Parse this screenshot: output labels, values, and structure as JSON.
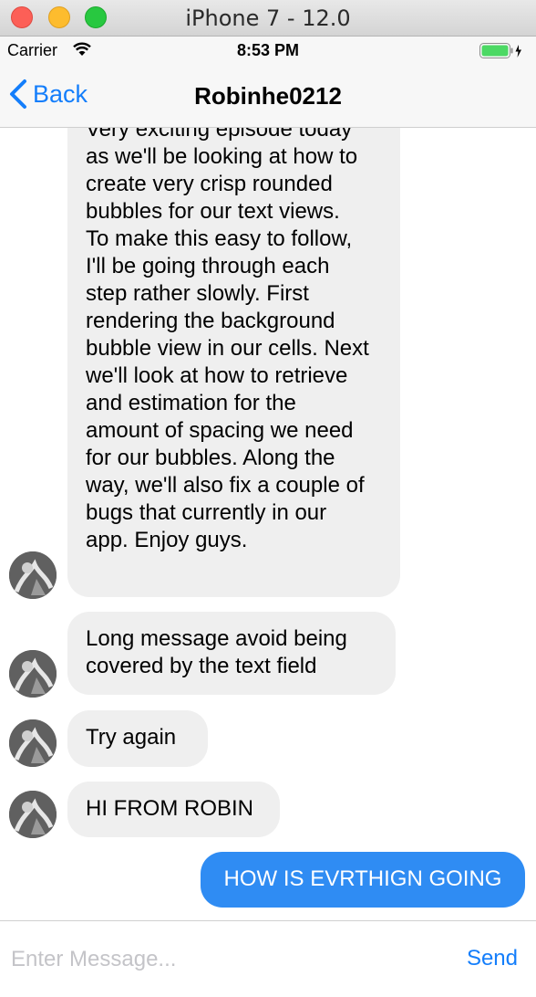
{
  "simulator": {
    "title": "iPhone 7 - 12.0"
  },
  "statusbar": {
    "carrier": "Carrier",
    "time": "8:53 PM"
  },
  "navbar": {
    "back_label": "Back",
    "title": "Robinhe0212"
  },
  "messages": [
    {
      "direction": "incoming",
      "lines": [
        "Very exciting episode today",
        "as we'll be looking at how to",
        "create very crisp rounded",
        "bubbles for our text views.",
        "To make this easy to follow,",
        "I'll be going through each",
        "step rather slowly. First",
        "rendering the background",
        "bubble view in our cells. Next",
        "we'll look at how to retrieve",
        "and estimation for the",
        "amount of spacing we need",
        "for our bubbles.  Along the",
        "way, we'll also fix a couple of",
        "bugs that currently in our",
        "app.  Enjoy guys."
      ]
    },
    {
      "direction": "incoming",
      "lines": [
        "Long message avoid being",
        "covered by the text field"
      ]
    },
    {
      "direction": "incoming",
      "lines": [
        "Try again"
      ]
    },
    {
      "direction": "incoming",
      "lines": [
        "HI FROM ROBIN"
      ]
    },
    {
      "direction": "outgoing",
      "lines": [
        "HOW IS EVRTHIGN GOING"
      ]
    }
  ],
  "input": {
    "placeholder": "Enter Message...",
    "value": ""
  },
  "send_label": "Send",
  "colors": {
    "accent": "#147efb",
    "outgoing_bubble": "#2f8cf3",
    "incoming_bubble": "#efefef"
  }
}
